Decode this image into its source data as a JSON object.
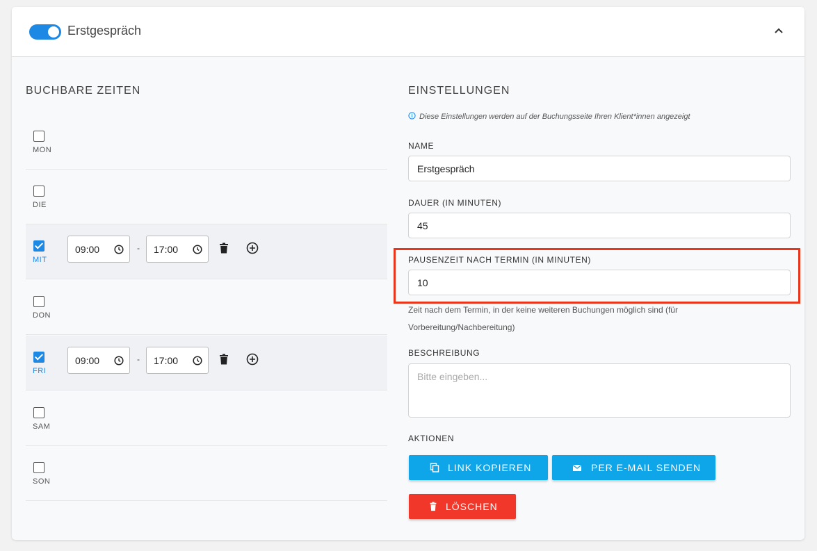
{
  "header": {
    "title": "Erstgespräch",
    "toggle_on": true
  },
  "left": {
    "title": "BUCHBARE ZEITEN",
    "days": [
      {
        "label": "MON",
        "checked": false
      },
      {
        "label": "DIE",
        "checked": false
      },
      {
        "label": "MIT",
        "checked": true,
        "from": "09:00",
        "to": "17:00"
      },
      {
        "label": "DON",
        "checked": false
      },
      {
        "label": "FRI",
        "checked": true,
        "from": "09:00",
        "to": "17:00"
      },
      {
        "label": "SAM",
        "checked": false
      },
      {
        "label": "SON",
        "checked": false
      }
    ],
    "dash": "-"
  },
  "right": {
    "title": "EINSTELLUNGEN",
    "info": "Diese Einstellungen werden auf der Buchungsseite Ihren Klient*innen angezeigt",
    "name_label": "NAME",
    "name_value": "Erstgespräch",
    "duration_label": "DAUER (IN MINUTEN)",
    "duration_value": "45",
    "pause_label": "PAUSENZEIT NACH TERMIN (IN MINUTEN)",
    "pause_value": "10",
    "pause_help": "Zeit nach dem Termin, in der keine weiteren Buchungen möglich sind (für Vorbereitung/Nachbereitung)",
    "description_label": "BESCHREIBUNG",
    "description_placeholder": "Bitte eingeben...",
    "actions_label": "AKTIONEN",
    "copy_link": "LINK KOPIEREN",
    "send_email": "PER E-MAIL SENDEN",
    "delete": "LÖSCHEN"
  },
  "colors": {
    "accent": "#1e88e5",
    "button_blue": "#0ea5e9",
    "button_red": "#f0372a",
    "highlight": "#e8361c"
  }
}
